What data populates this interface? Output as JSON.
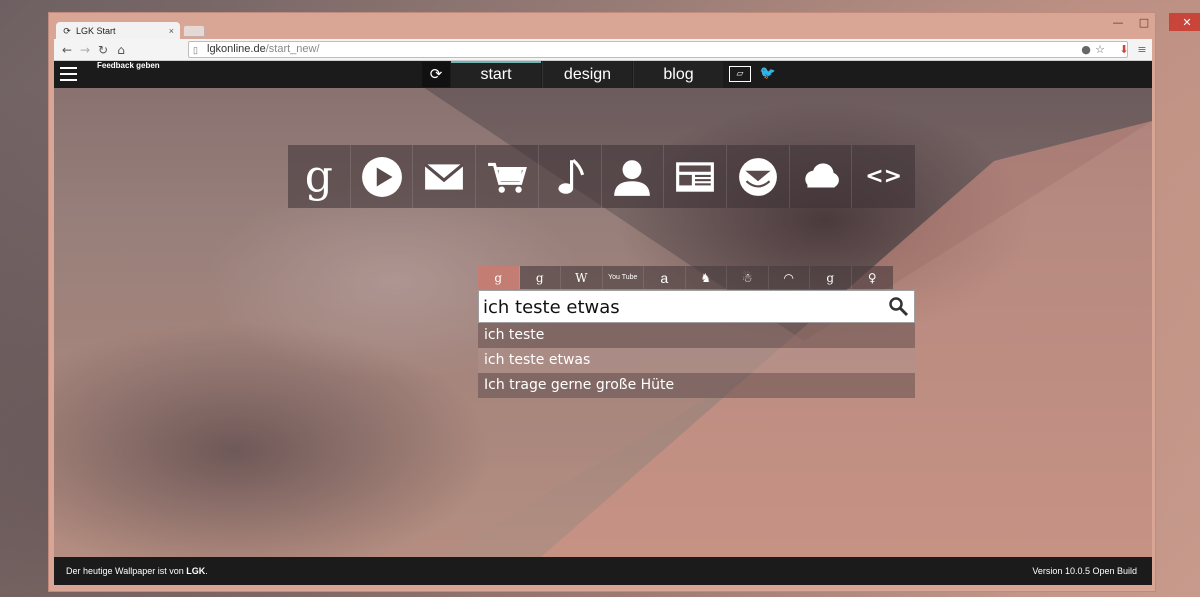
{
  "browser": {
    "tab_title": "LGK Start",
    "tab_close": "×",
    "url_host": "lgkonline.de",
    "url_path": "/start_new/",
    "window_min": "—",
    "window_max": "□",
    "window_close": "✕"
  },
  "nav": {
    "feedback": "Feedback geben",
    "tabs": [
      {
        "label": "start"
      },
      {
        "label": "design"
      },
      {
        "label": "blog"
      }
    ]
  },
  "apps": [
    "google",
    "youtube",
    "mail",
    "shopping",
    "music",
    "contacts",
    "news",
    "messenger",
    "cloud",
    "code"
  ],
  "apps_text": {
    "google": "g",
    "code": "<>"
  },
  "engines": {
    "labels": [
      "g",
      "g",
      "W",
      "You Tube",
      "a",
      "♞",
      "☃",
      "◠",
      "g",
      "♀"
    ],
    "active_index": 0
  },
  "search": {
    "value": "ich teste etwas"
  },
  "suggestions": [
    {
      "text": "ich teste"
    },
    {
      "text": "ich teste etwas"
    },
    {
      "text": "Ich trage gerne große Hüte"
    }
  ],
  "footer": {
    "wallpaper_prefix": "Der heutige Wallpaper ist von ",
    "wallpaper_author": "LGK",
    "wallpaper_suffix": ".",
    "version": "Version 10.0.5 Open Build"
  },
  "colors": {
    "accent": "#6fb7b7",
    "active_engine": "#c47d72",
    "bar": "#1b1b1b"
  }
}
